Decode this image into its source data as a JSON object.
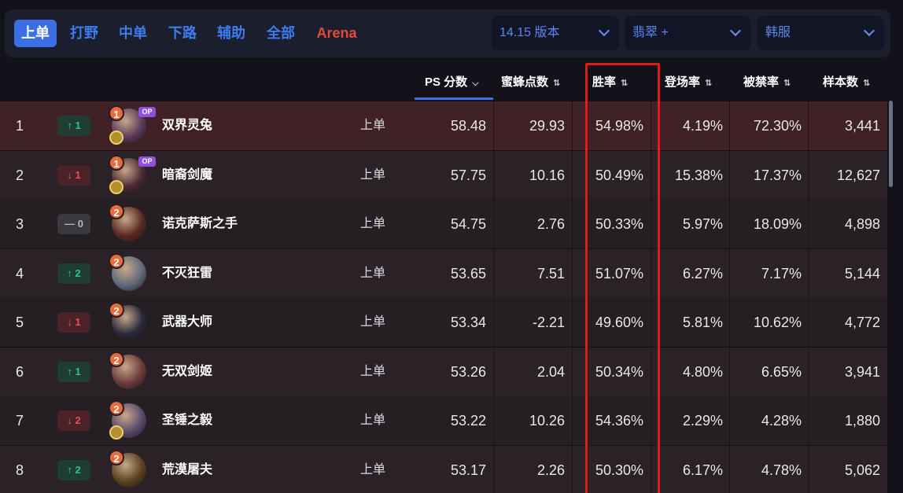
{
  "tabs": [
    {
      "label": "上单",
      "active": true
    },
    {
      "label": "打野"
    },
    {
      "label": "中单"
    },
    {
      "label": "下路"
    },
    {
      "label": "辅助"
    },
    {
      "label": "全部"
    },
    {
      "label": "Arena"
    }
  ],
  "filters": {
    "version": "14.15 版本",
    "rank": "翡翠 +",
    "region": "韩服"
  },
  "columns": {
    "ps": "PS 分数",
    "bee": "蜜蜂点数",
    "win": "胜率",
    "pick": "登场率",
    "ban": "被禁率",
    "sample": "样本数"
  },
  "rows": [
    {
      "rank": "1",
      "trend": "↑ 1",
      "tier_badge": "1",
      "op": "OP",
      "name": "双界灵兔",
      "role": "上单",
      "ps": "58.48",
      "bee": "29.93",
      "win": "54.98%",
      "pick": "4.19%",
      "ban": "72.30%",
      "sample": "3,441"
    },
    {
      "rank": "2",
      "trend": "↓ 1",
      "tier_badge": "1",
      "op": "OP",
      "name": "暗裔剑魔",
      "role": "上单",
      "ps": "57.75",
      "bee": "10.16",
      "win": "50.49%",
      "pick": "15.38%",
      "ban": "17.37%",
      "sample": "12,627"
    },
    {
      "rank": "3",
      "trend": "— 0",
      "tier_badge": "2",
      "name": "诺克萨斯之手",
      "role": "上单",
      "ps": "54.75",
      "bee": "2.76",
      "win": "50.33%",
      "pick": "5.97%",
      "ban": "18.09%",
      "sample": "4,898"
    },
    {
      "rank": "4",
      "trend": "↑ 2",
      "tier_badge": "2",
      "name": "不灭狂雷",
      "role": "上单",
      "ps": "53.65",
      "bee": "7.51",
      "win": "51.07%",
      "pick": "6.27%",
      "ban": "7.17%",
      "sample": "5,144"
    },
    {
      "rank": "5",
      "trend": "↓ 1",
      "tier_badge": "2",
      "name": "武器大师",
      "role": "上单",
      "ps": "53.34",
      "bee": "-2.21",
      "win": "49.60%",
      "pick": "5.81%",
      "ban": "10.62%",
      "sample": "4,772"
    },
    {
      "rank": "6",
      "trend": "↑ 1",
      "tier_badge": "2",
      "name": "无双剑姬",
      "role": "上单",
      "ps": "53.26",
      "bee": "2.04",
      "win": "50.34%",
      "pick": "4.80%",
      "ban": "6.65%",
      "sample": "3,941"
    },
    {
      "rank": "7",
      "trend": "↓ 2",
      "tier_badge": "2",
      "name": "圣锤之毅",
      "role": "上单",
      "ps": "53.22",
      "bee": "10.26",
      "win": "54.36%",
      "pick": "2.29%",
      "ban": "4.28%",
      "sample": "1,880"
    },
    {
      "rank": "8",
      "trend": "↑ 2",
      "tier_badge": "2",
      "name": "荒漠屠夫",
      "role": "上单",
      "ps": "53.17",
      "bee": "2.26",
      "win": "50.30%",
      "pick": "6.17%",
      "ban": "4.78%",
      "sample": "5,062"
    }
  ],
  "colors": {
    "accent": "#3d6fe4",
    "arena": "#e04a3a",
    "up": "#2ec28a",
    "down": "#e0535d",
    "highlight_box": "#e1191d"
  }
}
